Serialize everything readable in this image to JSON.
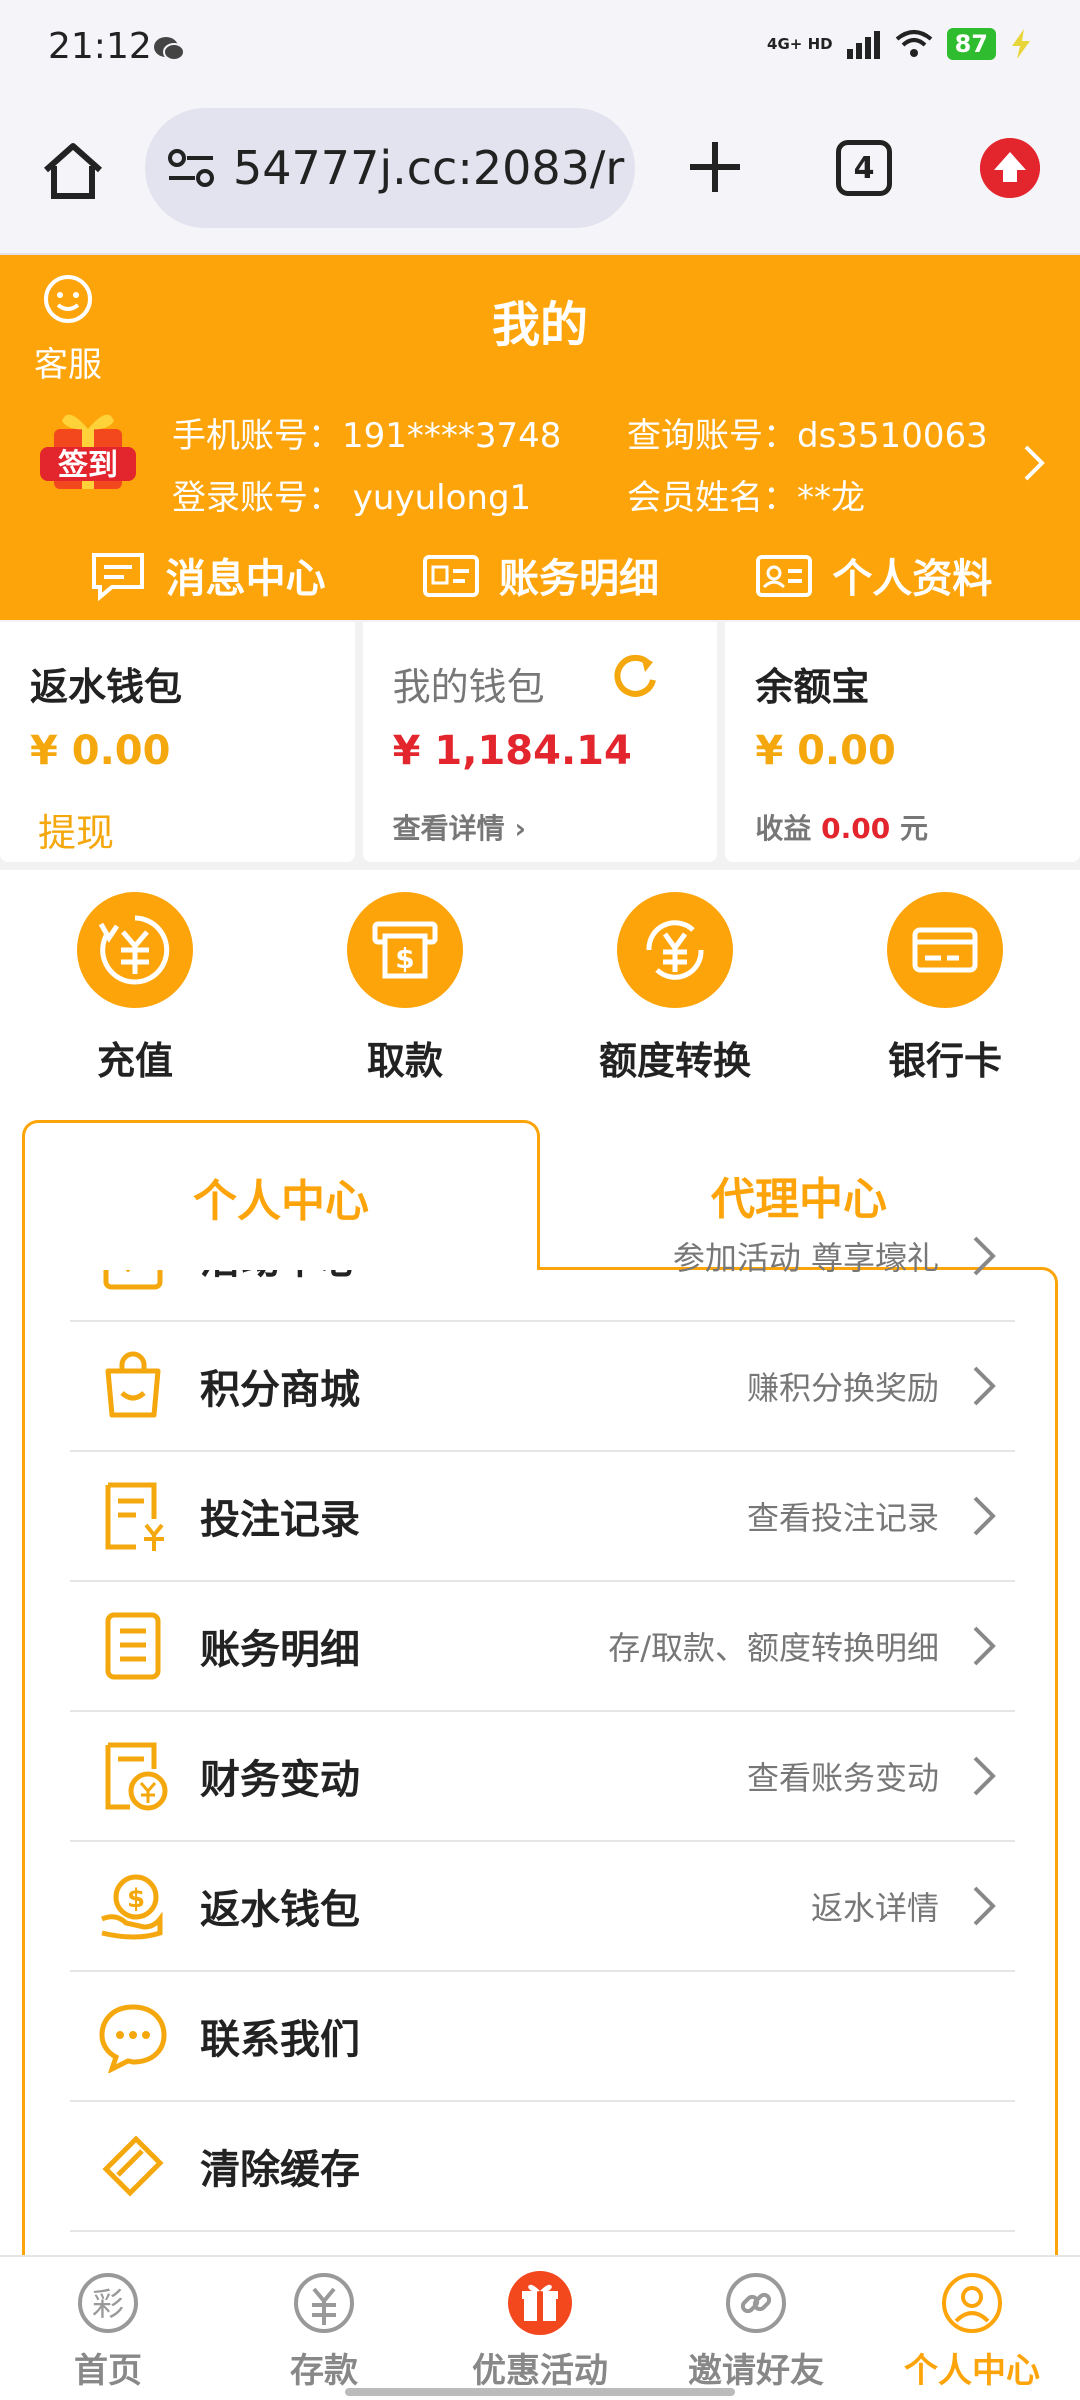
{
  "status_bar": {
    "time": "21:12",
    "network": "4G+ HD",
    "battery": "87"
  },
  "browser": {
    "url": "54777j.cc:2083/r",
    "tab_count": "4"
  },
  "header": {
    "customer_service": "客服",
    "title": "我的",
    "signin_badge": "签到",
    "phone_account": "手机账号：191****3748",
    "query_account": "查询账号：ds3510063",
    "login_account": "登录账号： yuyulong1",
    "member_name": "会员姓名：**龙",
    "shortcuts": [
      "消息中心",
      "账务明细",
      "个人资料"
    ]
  },
  "wallets": {
    "rebate": {
      "title": "返水钱包",
      "amount": "¥ 0.00",
      "action": "提现"
    },
    "main": {
      "title": "我的钱包",
      "amount": "¥ 1,184.14",
      "detail": "查看详情"
    },
    "yuebao": {
      "title": "余额宝",
      "amount": "¥ 0.00",
      "earnings_label": "收益",
      "earnings_value": "0.00",
      "earnings_unit": "元"
    }
  },
  "actions": [
    "充值",
    "取款",
    "额度转换",
    "银行卡"
  ],
  "tabs": {
    "active": "个人中心",
    "inactive": "代理中心"
  },
  "menu": [
    {
      "label": "活动中心",
      "hint": "参加活动 尊享壕礼"
    },
    {
      "label": "积分商城",
      "hint": "赚积分换奖励"
    },
    {
      "label": "投注记录",
      "hint": "查看投注记录"
    },
    {
      "label": "账务明细",
      "hint": "存/取款、额度转换明细"
    },
    {
      "label": "财务变动",
      "hint": "查看账务变动"
    },
    {
      "label": "返水钱包",
      "hint": "返水详情"
    },
    {
      "label": "联系我们",
      "hint": ""
    },
    {
      "label": "清除缓存",
      "hint": ""
    }
  ],
  "bottom_nav": [
    "首页",
    "存款",
    "优惠活动",
    "邀请好友",
    "个人中心"
  ],
  "colors": {
    "accent": "#fda40a",
    "price_red": "#e3262e"
  }
}
